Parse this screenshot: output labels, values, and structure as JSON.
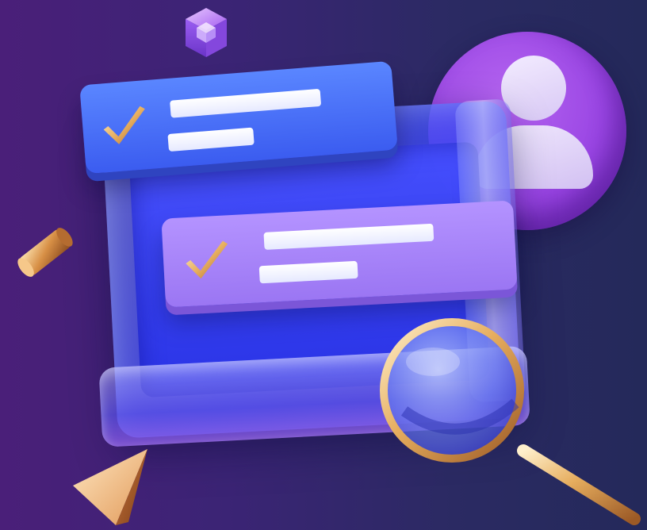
{
  "scene": {
    "description_shapes": [
      "cube-icon",
      "avatar-icon",
      "checklist-card",
      "checklist-card",
      "magnifier-icon",
      "cylinder-shape",
      "pyramid-shape"
    ]
  },
  "colors": {
    "background_left": "#4a1f79",
    "background_right": "#24295a",
    "card_blue": "#4a72f8",
    "card_purple": "#a785fa",
    "avatar": "#9a46e4",
    "gold": "#e9b46a"
  },
  "cards": [
    {
      "checked": true,
      "lines": 2
    },
    {
      "checked": true,
      "lines": 2
    }
  ]
}
